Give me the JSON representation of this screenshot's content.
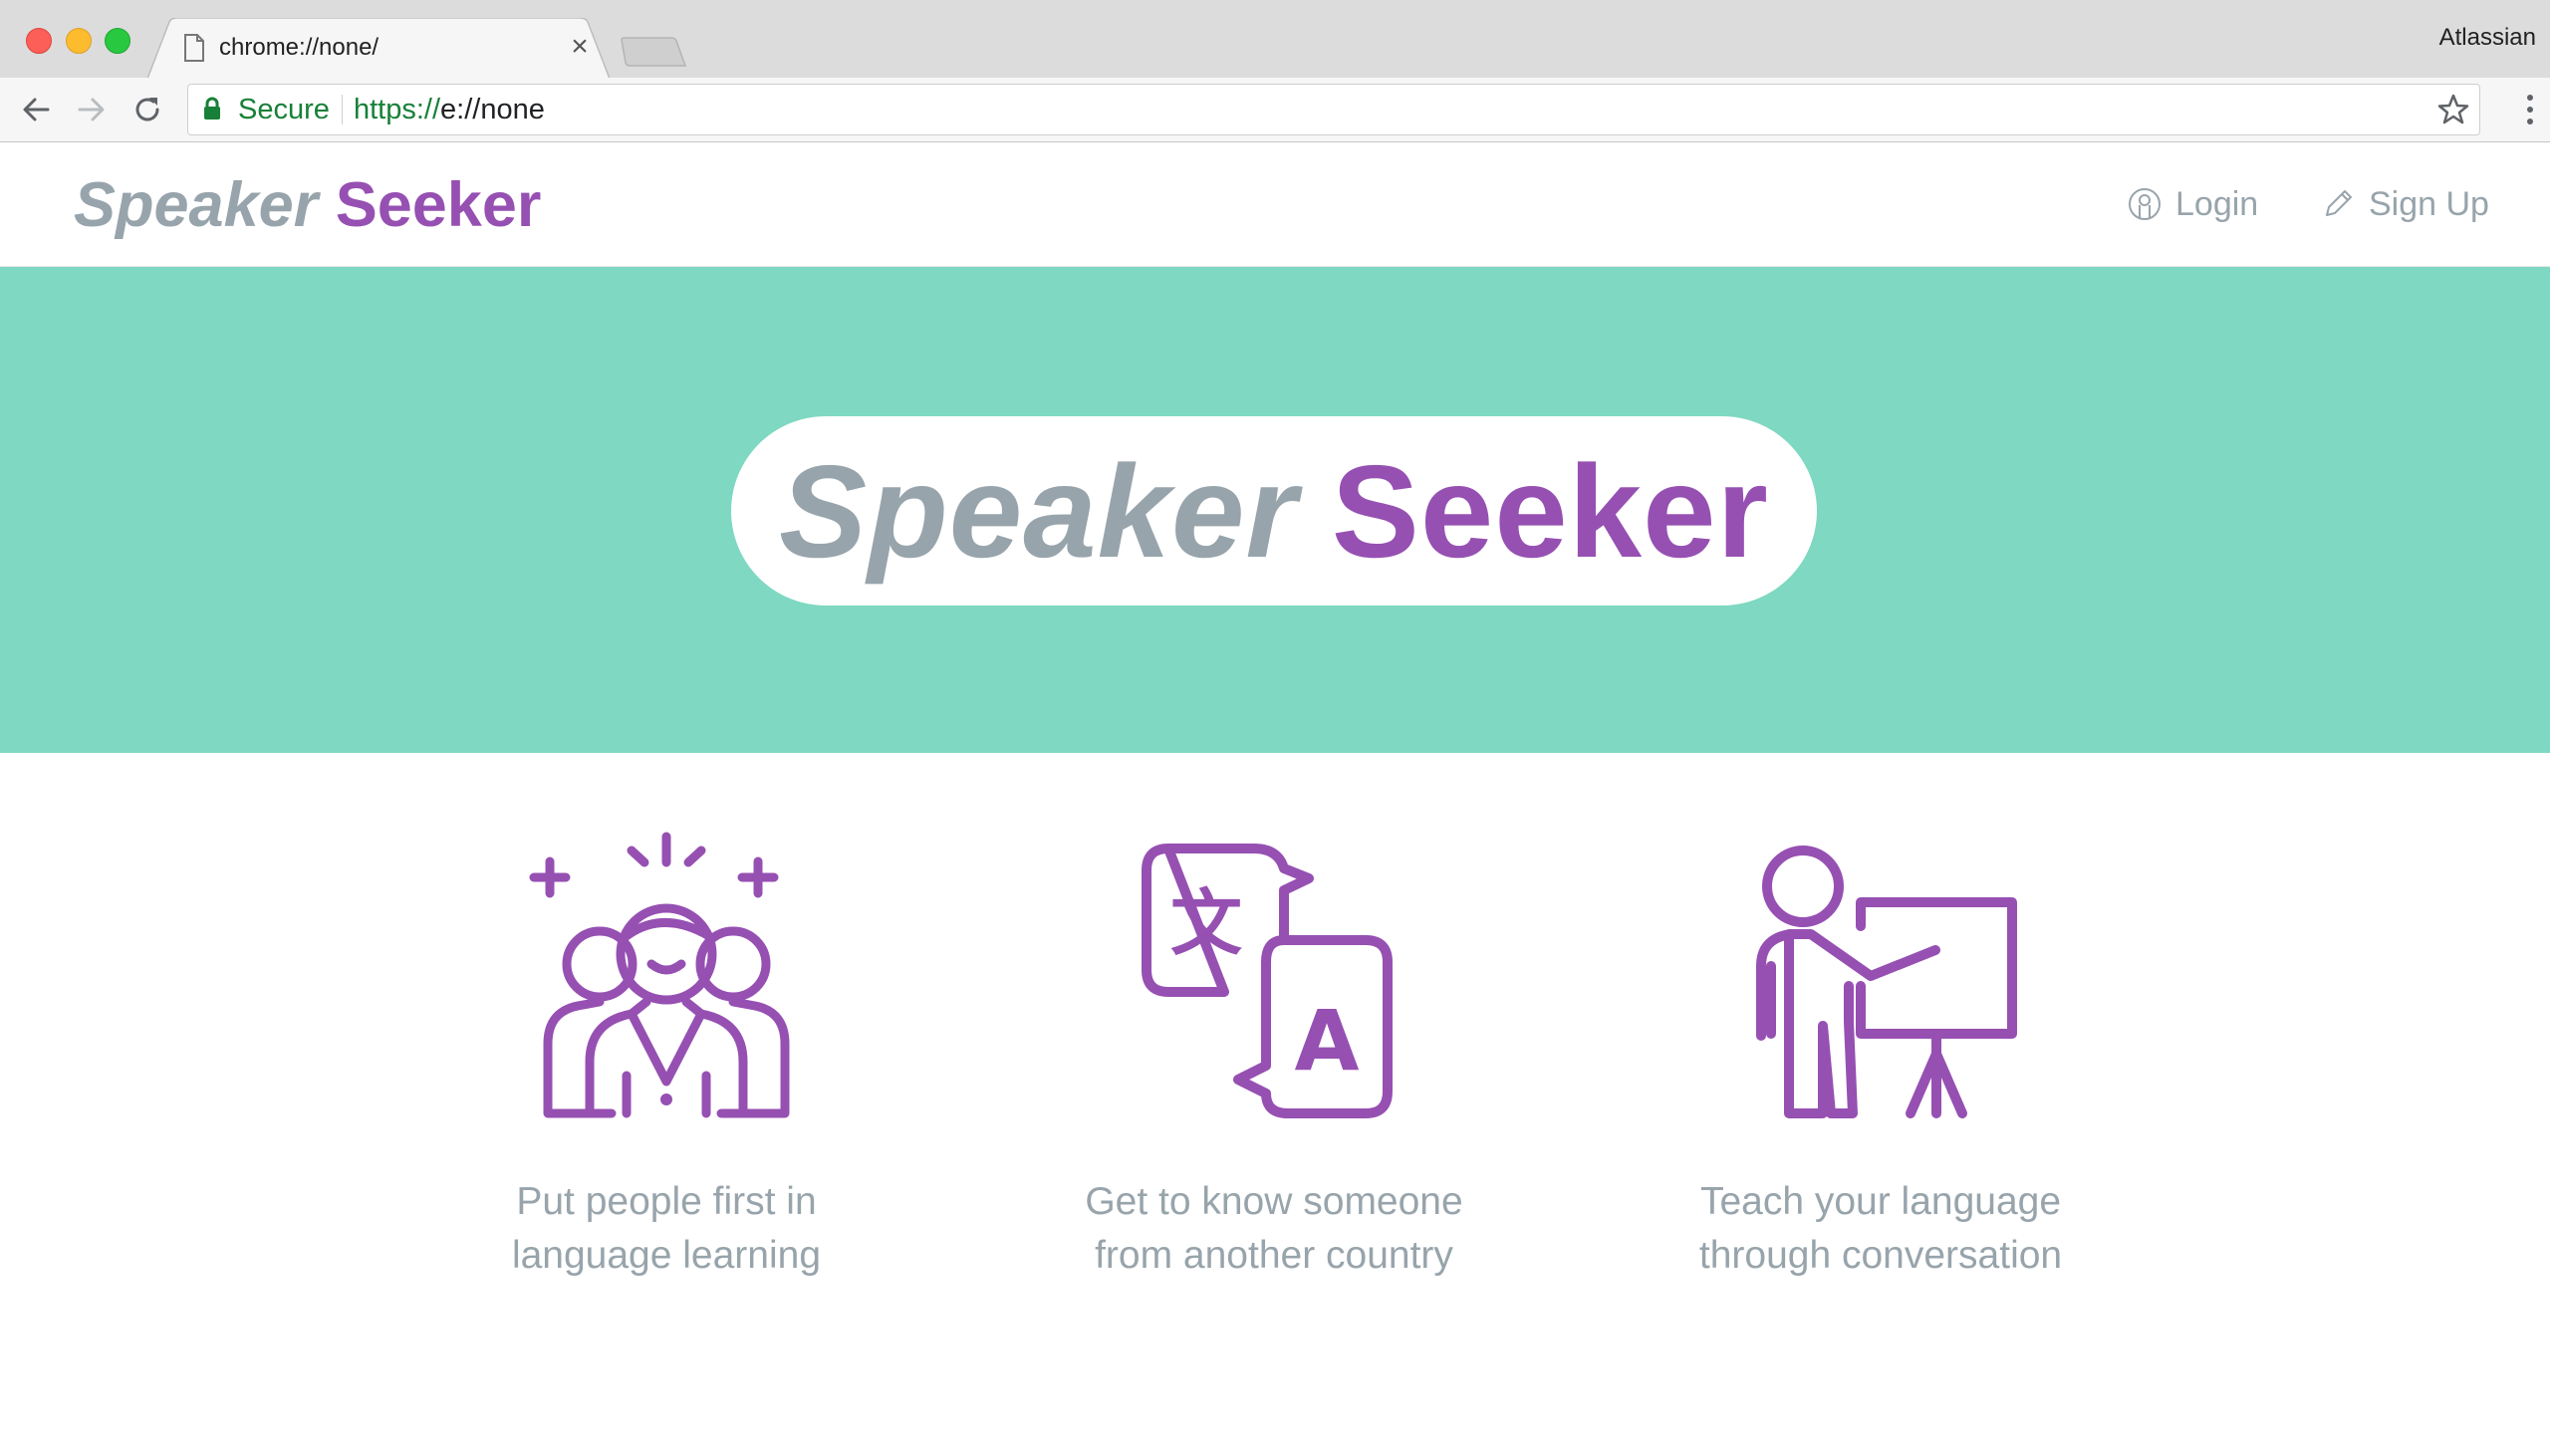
{
  "browser": {
    "tab_title": "chrome://none/",
    "tab_close": "×",
    "profile_name": "Atlassian",
    "security_label": "Secure",
    "url_scheme": "https://",
    "url_rest": "e://none"
  },
  "header": {
    "brand_first": "Speaker",
    "brand_second": "Seeker",
    "login_label": "Login",
    "signup_label": "Sign Up"
  },
  "hero": {
    "title_first": "Speaker",
    "title_second": "Seeker"
  },
  "features": [
    {
      "icon": "team-people-icon",
      "line1": "Put people first in",
      "line2": "language learning"
    },
    {
      "icon": "translate-icon",
      "line1": "Get to know someone",
      "line2": "from another country"
    },
    {
      "icon": "teacher-presentation-icon",
      "line1": "Teach your language",
      "line2": "through conversation"
    }
  ],
  "colors": {
    "brand_purple": "#9650b2",
    "brand_gray": "#98a4ab",
    "hero_teal": "#7fd8c1",
    "secure_green": "#188038"
  }
}
